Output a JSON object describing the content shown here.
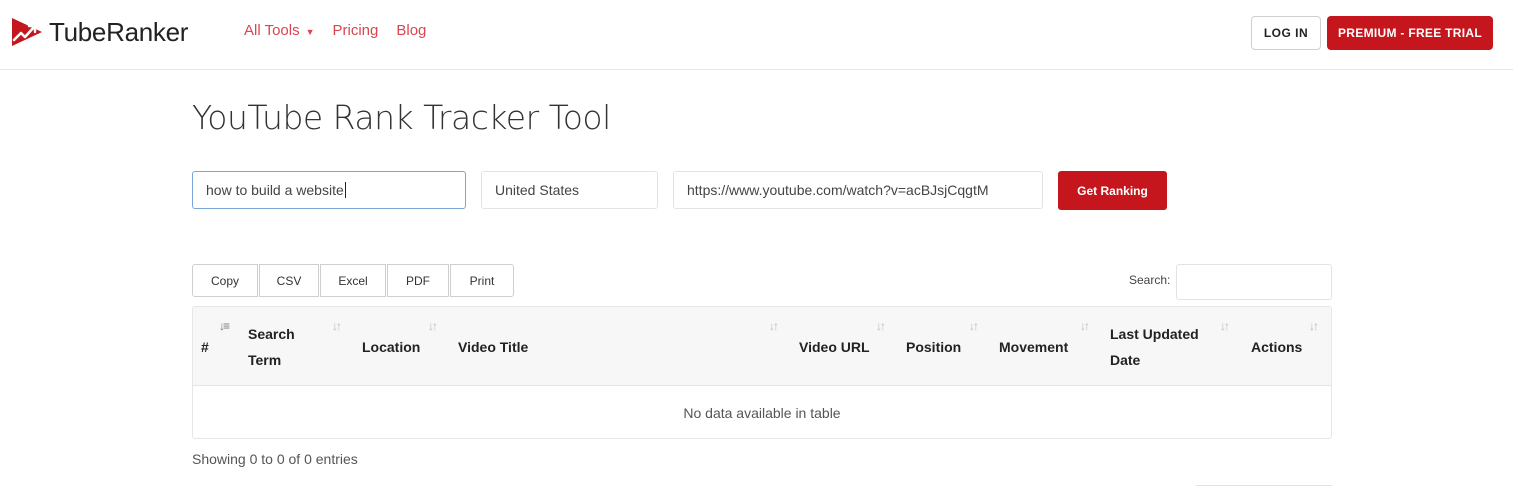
{
  "brand": {
    "name": "TubeRanker",
    "color": "#c4161c"
  },
  "nav": {
    "items": [
      {
        "label": "All Tools",
        "has_dropdown": true
      },
      {
        "label": "Pricing"
      },
      {
        "label": "Blog"
      }
    ],
    "login_label": "LOG IN",
    "premium_label": "PREMIUM - FREE TRIAL"
  },
  "main": {
    "title": "YouTube Rank Tracker Tool",
    "keyword_value": "how to build a website",
    "location_value": "United States",
    "url_value": "https://www.youtube.com/watch?v=acBJsjCqgtM",
    "get_ranking_label": "Get Ranking"
  },
  "toolbar": {
    "buttons": [
      "Copy",
      "CSV",
      "Excel",
      "PDF",
      "Print"
    ],
    "search_label": "Search:"
  },
  "table": {
    "columns": [
      "#",
      "Search Term",
      "Location",
      "Video Title",
      "Video URL",
      "Position",
      "Movement",
      "Last Updated Date",
      "Actions"
    ],
    "empty_message": "No data available in table",
    "info": "Showing 0 to 0 of 0 entries"
  },
  "icons": {
    "logo": "play-trend-logo-icon",
    "sort": "sort-arrows-icon",
    "sort_active": "sort-numeric-asc-icon",
    "caret": "chevron-down-icon"
  }
}
